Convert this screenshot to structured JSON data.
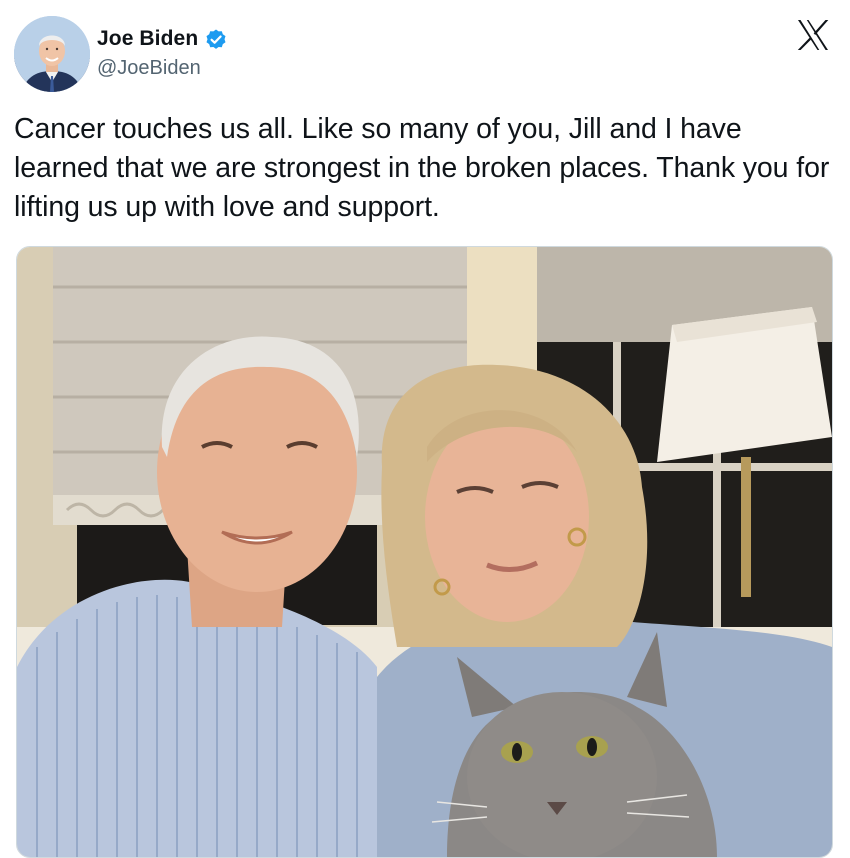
{
  "author": {
    "display_name": "Joe Biden",
    "handle": "@JoeBiden",
    "verified": true
  },
  "tweet": {
    "text": "Cancer touches us all. Like so many of you, Jill and I have learned that we are strongest in the broken places. Thank you for lifting us up with love and support."
  },
  "media": {
    "type": "photo"
  },
  "icons": {
    "avatar": "profile-photo",
    "verified": "verified-badge-icon",
    "platform": "x-logo-icon"
  },
  "colors": {
    "verified_blue": "#1d9bf0",
    "handle_gray": "#536471",
    "text": "#0f1419"
  }
}
